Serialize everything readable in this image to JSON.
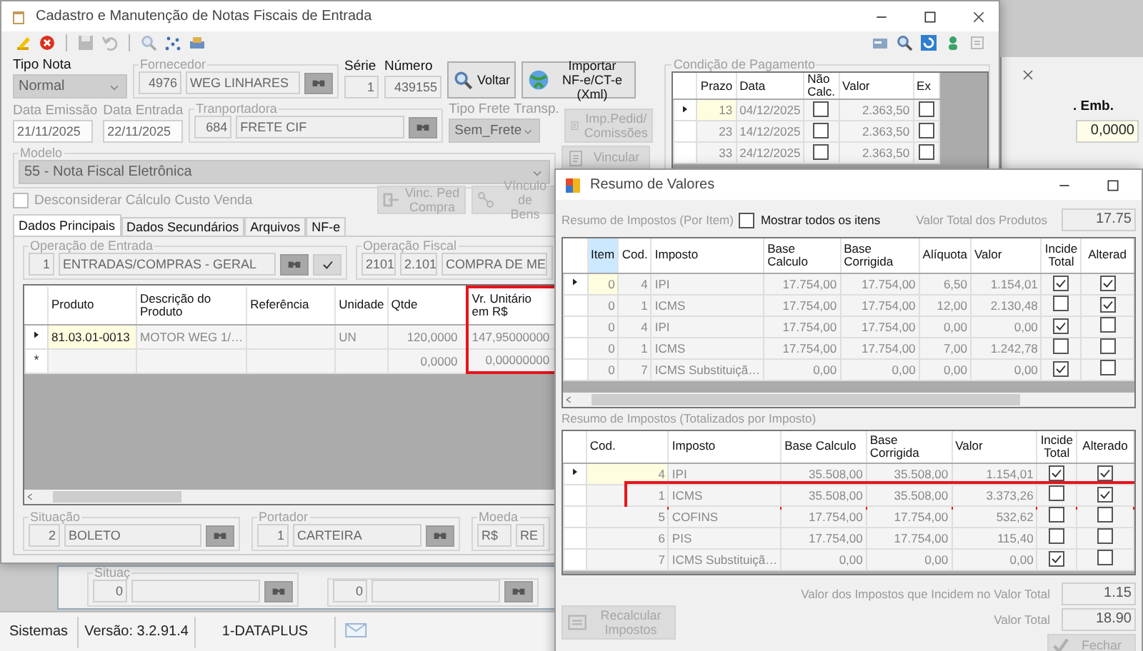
{
  "main_window": {
    "title": "Cadastro e Manutenção de Notas Fiscais de Entrada",
    "toolbar": [
      {
        "kind": "edit",
        "disabled": false
      },
      {
        "kind": "cancel",
        "disabled": false
      },
      {
        "kind": "save",
        "disabled": true
      },
      {
        "kind": "undo",
        "disabled": true
      },
      {
        "kind": "search",
        "disabled": true
      },
      {
        "kind": "scatter",
        "disabled": false
      },
      {
        "kind": "print",
        "disabled": false
      }
    ],
    "toolbar_right": [
      {
        "kind": "card",
        "disabled": false
      },
      {
        "kind": "search",
        "disabled": false
      },
      {
        "kind": "refresh",
        "disabled": false
      },
      {
        "kind": "user",
        "disabled": false
      },
      {
        "kind": "menu",
        "disabled": true
      }
    ]
  },
  "header": {
    "tipo_nota": {
      "label": "Tipo Nota",
      "value": "Normal"
    },
    "fornecedor": {
      "label": "Fornecedor",
      "code": "4976",
      "name": "WEG LINHARES"
    },
    "serie": {
      "label": "Série",
      "value": "1"
    },
    "numero": {
      "label": "Número",
      "value": "439155"
    },
    "data_emissao": {
      "label": "Data Emissão",
      "value": "21/11/2025"
    },
    "data_entrada": {
      "label": "Data Entrada",
      "value": "22/11/2025"
    },
    "transportadora": {
      "label": "Tranportadora",
      "code": "684",
      "name": "FRETE CIF"
    },
    "tipo_frete": {
      "label": "Tipo Frete Transp.",
      "value": "Sem_Frete"
    },
    "modelo": {
      "label": "Modelo",
      "value": "55 - Nota Fiscal Eletrônica"
    },
    "desconsiderar": {
      "label": "Desconsiderar Cálculo Custo Venda",
      "checked": false
    }
  },
  "buttons": {
    "voltar": {
      "label": "Voltar",
      "disabled": false
    },
    "importar": {
      "label": "Importar\nNF-e/CT-e (Xml)",
      "disabled": false
    },
    "imp_pedid": {
      "label": "Imp.Pedid/\nComissões",
      "disabled": true
    },
    "vincular": {
      "label": "Vincular",
      "disabled": true
    },
    "vinc_ped": {
      "label": "Vinc. Ped\nCompra",
      "disabled": true
    },
    "vinculo_bens": {
      "label": "Vínculo de\nBens",
      "disabled": true
    }
  },
  "pagamento": {
    "title": "Condição de Pagamento",
    "columns": [
      "Prazo",
      "Data",
      "Não\nCalc.",
      "Valor",
      "Ex"
    ],
    "rows": [
      {
        "current": true,
        "prazo": "13",
        "data": "04/12/2025",
        "nao_calc": false,
        "valor": "2.363,50",
        "ex": false
      },
      {
        "current": false,
        "prazo": "23",
        "data": "14/12/2025",
        "nao_calc": false,
        "valor": "2.363,50",
        "ex": false
      },
      {
        "current": false,
        "prazo": "33",
        "data": "24/12/2025",
        "nao_calc": false,
        "valor": "2.363,50",
        "ex": false
      }
    ]
  },
  "tabs": [
    {
      "label": "Dados Principais",
      "selected": true
    },
    {
      "label": "Dados Secundários",
      "selected": false
    },
    {
      "label": "Arquivos",
      "selected": false
    },
    {
      "label": "NF-e",
      "selected": false
    }
  ],
  "operacao_entrada": {
    "label": "Operação de Entrada",
    "code": "1",
    "name": "ENTRADAS/COMPRAS - GERAL"
  },
  "operacao_fiscal": {
    "label": "Operação Fiscal",
    "code": "2101",
    "cfop": "2.101",
    "name": "COMPRA DE ME"
  },
  "items_table": {
    "columns": [
      {
        "label": "Produto",
        "highlighted": false
      },
      {
        "label": "Descrição do\nProduto",
        "highlighted": false
      },
      {
        "label": "Referência",
        "highlighted": false
      },
      {
        "label": "Unidade",
        "highlighted": false
      },
      {
        "label": "Qtde",
        "highlighted": false
      },
      {
        "label": "Vr. Unitário\nem R$",
        "highlighted": true
      }
    ],
    "rows": [
      {
        "current": true,
        "produto": "81.03.01-0013",
        "descricao": "MOTOR WEG 1/…",
        "unidade": "UN",
        "qtde": "120,0000",
        "vr_unitario": "147,95000000"
      },
      {
        "current": false,
        "marker": "*",
        "qtde": "0,0000",
        "vr_unitario": "0,00000000"
      }
    ]
  },
  "situacao": {
    "label": "Situação",
    "code": "2",
    "name": "BOLETO"
  },
  "portador": {
    "label": "Portador",
    "code": "1",
    "name": "CARTEIRA"
  },
  "moeda": {
    "label": "Moeda",
    "code": "R$",
    "name": "RE"
  },
  "back_window": {
    "label": "Situaç",
    "codes": [
      "0",
      "0"
    ]
  },
  "right_window": {
    "label": ". Emb.",
    "value": "0,0000"
  },
  "resumo": {
    "title": "Resumo de Valores",
    "por_item_label": "Resumo de Impostos (Por Item)",
    "mostrar_todos": {
      "label": "Mostrar todos os itens",
      "checked": false
    },
    "valor_total_produtos": {
      "label": "Valor Total dos Produtos",
      "value": "17.75"
    },
    "item_table": {
      "columns": [
        "Item",
        "Cod.",
        "Imposto",
        "Base Calculo",
        "Base Corrigida",
        "Alíquota",
        "Valor",
        "Incide\nTotal",
        "Alterad"
      ],
      "rows": [
        {
          "current": true,
          "item": "0",
          "cod": "4",
          "imposto": "IPI",
          "base_calculo": "17.754,00",
          "base_corrigida": "17.754,00",
          "aliquota": "6,50",
          "valor": "1.154,01",
          "incide_total": true,
          "alterado": true
        },
        {
          "current": false,
          "item": "0",
          "cod": "1",
          "imposto": "ICMS",
          "base_calculo": "17.754,00",
          "base_corrigida": "17.754,00",
          "aliquota": "12,00",
          "valor": "2.130,48",
          "incide_total": false,
          "alterado": true
        },
        {
          "current": false,
          "item": "0",
          "cod": "4",
          "imposto": "IPI",
          "base_calculo": "17.754,00",
          "base_corrigida": "17.754,00",
          "aliquota": "0,00",
          "valor": "0,00",
          "incide_total": true,
          "alterado": false
        },
        {
          "current": false,
          "item": "0",
          "cod": "1",
          "imposto": "ICMS",
          "base_calculo": "17.754,00",
          "base_corrigida": "17.754,00",
          "aliquota": "7,00",
          "valor": "1.242,78",
          "incide_total": false,
          "alterado": false
        },
        {
          "current": false,
          "item": "0",
          "cod": "7",
          "imposto": "ICMS Substituiçã…",
          "base_calculo": "0,00",
          "base_corrigida": "0,00",
          "aliquota": "0,00",
          "valor": "0,00",
          "incide_total": true,
          "alterado": false
        }
      ]
    },
    "totalizados_label": "Resumo de Impostos (Totalizados por Imposto)",
    "total_table": {
      "columns": [
        "Cod.",
        "Imposto",
        "Base Calculo",
        "Base Corrigida",
        "Valor",
        "Incide\nTotal",
        "Alterado"
      ],
      "rows": [
        {
          "current": true,
          "highlighted": false,
          "cod": "4",
          "imposto": "IPI",
          "base_calculo": "35.508,00",
          "base_corrigida": "35.508,00",
          "valor": "1.154,01",
          "incide_total": true,
          "alterado": true
        },
        {
          "current": false,
          "highlighted": true,
          "cod": "1",
          "imposto": "ICMS",
          "base_calculo": "35.508,00",
          "base_corrigida": "35.508,00",
          "valor": "3.373,26",
          "incide_total": false,
          "alterado": true
        },
        {
          "current": false,
          "highlighted": false,
          "cod": "5",
          "imposto": "COFINS",
          "base_calculo": "17.754,00",
          "base_corrigida": "17.754,00",
          "valor": "532,62",
          "incide_total": false,
          "alterado": false
        },
        {
          "current": false,
          "highlighted": false,
          "cod": "6",
          "imposto": "PIS",
          "base_calculo": "17.754,00",
          "base_corrigida": "17.754,00",
          "valor": "115,40",
          "incide_total": false,
          "alterado": false
        },
        {
          "current": false,
          "highlighted": false,
          "cod": "7",
          "imposto": "ICMS Substituiçã…",
          "base_calculo": "0,00",
          "base_corrigida": "0,00",
          "valor": "0,00",
          "incide_total": true,
          "alterado": false
        }
      ]
    },
    "valor_impostos": {
      "label": "Valor dos Impostos que Incidem no Valor Total",
      "value": "1.15"
    },
    "valor_total": {
      "label": "Valor Total",
      "value": "18.90"
    },
    "recalcular": {
      "label": "Recalcular\nImpostos",
      "disabled": true
    },
    "fechar": {
      "label": "Fechar",
      "disabled": true
    }
  },
  "status_bar": [
    "Sistemas",
    "Versão: 3.2.91.4",
    "1-DATAPLUS"
  ]
}
